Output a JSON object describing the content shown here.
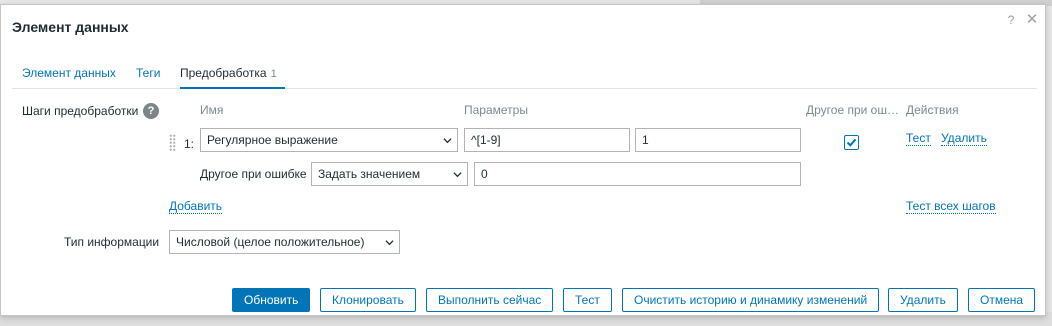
{
  "modal": {
    "title": "Элемент данных",
    "help_glyph": "?",
    "close_glyph": "✕"
  },
  "tabs": [
    {
      "label": "Элемент данных"
    },
    {
      "label": "Теги"
    },
    {
      "label": "Предобработка",
      "count": "1"
    }
  ],
  "preprocessing": {
    "label": "Шаги предобработки",
    "help_glyph": "?",
    "columns": {
      "name": "Имя",
      "params": "Параметры",
      "on_fail": "Другое при ош…",
      "actions": "Действия"
    },
    "step": {
      "number": "1:",
      "type": "Регулярное выражение",
      "param1": "^[1-9]",
      "param2": "1",
      "on_fail_checked": true,
      "test_link": "Тест",
      "remove_link": "Удалить",
      "on_fail_label": "Другое при ошибке",
      "on_fail_action": "Задать значением",
      "on_fail_value": "0"
    },
    "add_link": "Добавить",
    "test_all_link": "Тест всех шагов"
  },
  "info_type": {
    "label": "Тип информации",
    "value": "Числовой (целое положительное)"
  },
  "buttons": {
    "update": "Обновить",
    "clone": "Клонировать",
    "execute_now": "Выполнить сейчас",
    "test": "Тест",
    "clear_history": "Очистить историю и динамику изменений",
    "delete": "Удалить",
    "cancel": "Отмена"
  },
  "colors": {
    "accent": "#0275b8",
    "text": "#1f2c33",
    "muted": "#7a8b94"
  }
}
